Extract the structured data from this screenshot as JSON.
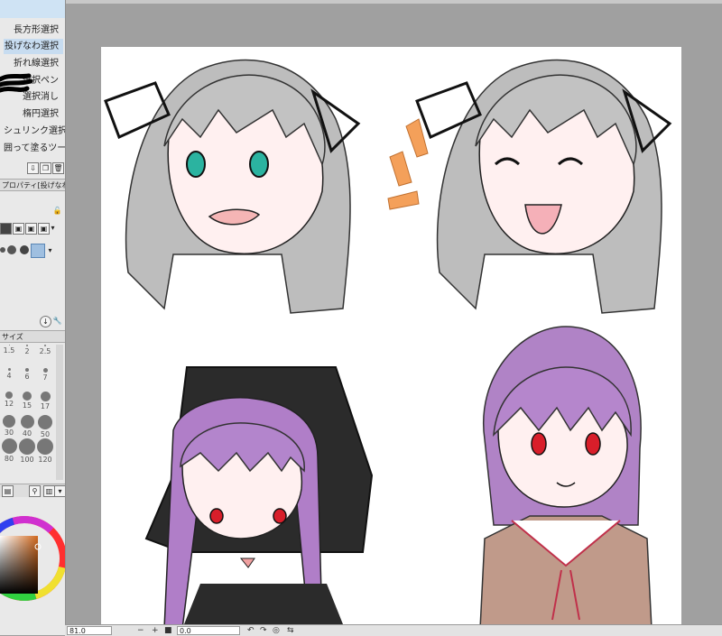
{
  "tools": {
    "items": [
      {
        "label": "長方形選択",
        "selected": false
      },
      {
        "label": "投げなわ選択",
        "selected": true
      },
      {
        "label": "折れ線選択",
        "selected": false
      },
      {
        "label": "選択ペン",
        "selected": false
      },
      {
        "label": "選択消し",
        "selected": false
      },
      {
        "label": "楕円選択",
        "selected": false
      },
      {
        "label": "シュリンク選択",
        "selected": false
      },
      {
        "label": "囲って塗るツール",
        "selected": false
      }
    ]
  },
  "property_tab": {
    "label": "プロパティ[投げなわ選択]"
  },
  "brush_tab": {
    "label": "サイズ"
  },
  "brush_sizes": [
    "1.5",
    "2",
    "2.5",
    "4",
    "6",
    "7",
    "12",
    "15",
    "17",
    "30",
    "40",
    "50",
    "80",
    "100",
    "120"
  ],
  "status": {
    "zoom": "81.0",
    "angle": "0.0"
  },
  "colors": {
    "accent_selected": "#c7dcf0",
    "paper": "#ffffff",
    "workspace": "#a0a0a0"
  }
}
